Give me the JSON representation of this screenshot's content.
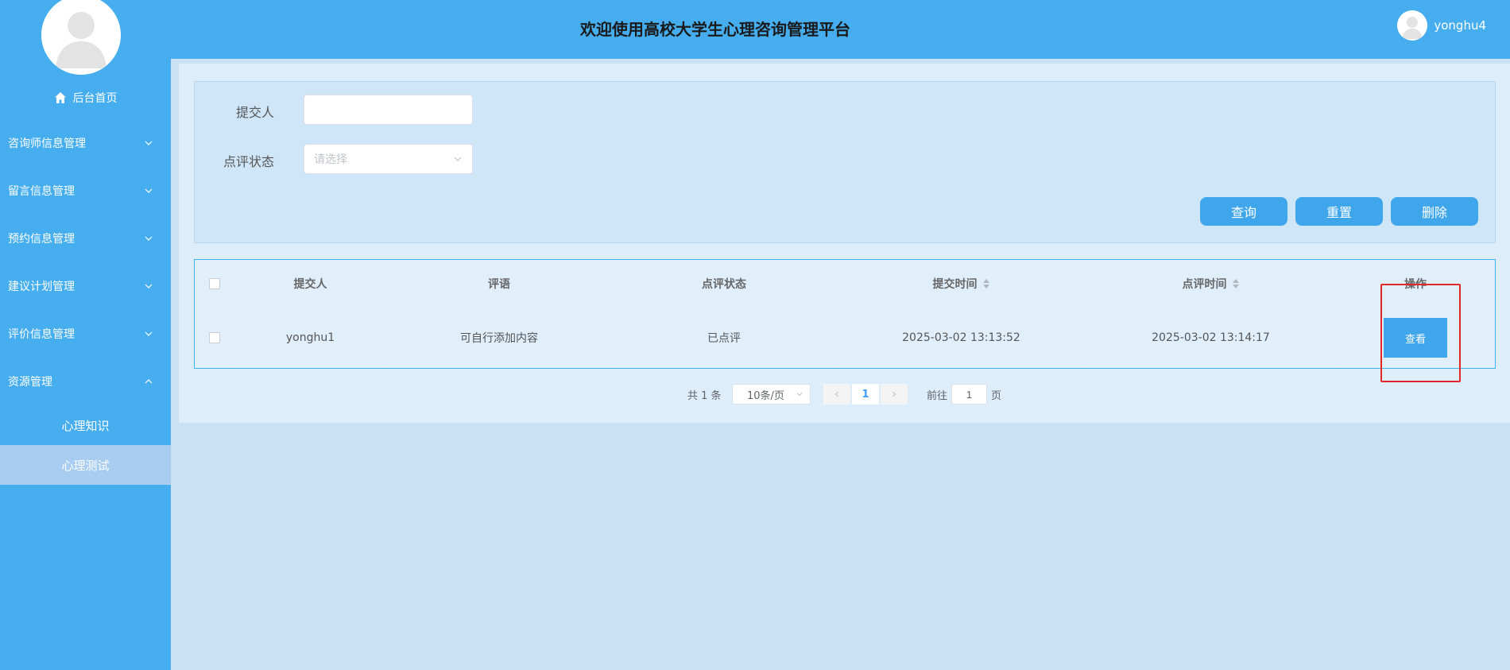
{
  "header": {
    "title": "欢迎使用高校大学生心理咨询管理平台",
    "username": "yonghu4"
  },
  "sidebar": {
    "home_label": "后台首页",
    "items": [
      {
        "label": "咨询师信息管理",
        "expanded": false
      },
      {
        "label": "留言信息管理",
        "expanded": false
      },
      {
        "label": "预约信息管理",
        "expanded": false
      },
      {
        "label": "建议计划管理",
        "expanded": false
      },
      {
        "label": "评价信息管理",
        "expanded": false
      },
      {
        "label": "资源管理",
        "expanded": true
      }
    ],
    "subitems": [
      {
        "label": "心理知识",
        "active": false
      },
      {
        "label": "心理测试",
        "active": true
      }
    ]
  },
  "search": {
    "submitter_label": "提交人",
    "submitter_value": "",
    "status_label": "点评状态",
    "status_placeholder": "请选择",
    "query_button": "查询",
    "reset_button": "重置",
    "delete_button": "删除"
  },
  "table": {
    "columns": [
      "提交人",
      "评语",
      "点评状态",
      "提交时间",
      "点评时间",
      "操作"
    ],
    "rows": [
      {
        "submitter": "yonghu1",
        "comment": "可自行添加内容",
        "status": "已点评",
        "submit_time": "2025-03-02 13:13:52",
        "review_time": "2025-03-02 13:14:17",
        "action": "查看"
      }
    ]
  },
  "pagination": {
    "total_text": "共 1 条",
    "page_size": "10条/页",
    "current_page": "1",
    "goto_label": "前往",
    "goto_value": "1",
    "goto_unit": "页"
  },
  "colors": {
    "sidebar_bg": "#46adef",
    "topbar_bg": "#46adef",
    "button_bg": "#3fa6ec",
    "highlight": "#e32626"
  }
}
